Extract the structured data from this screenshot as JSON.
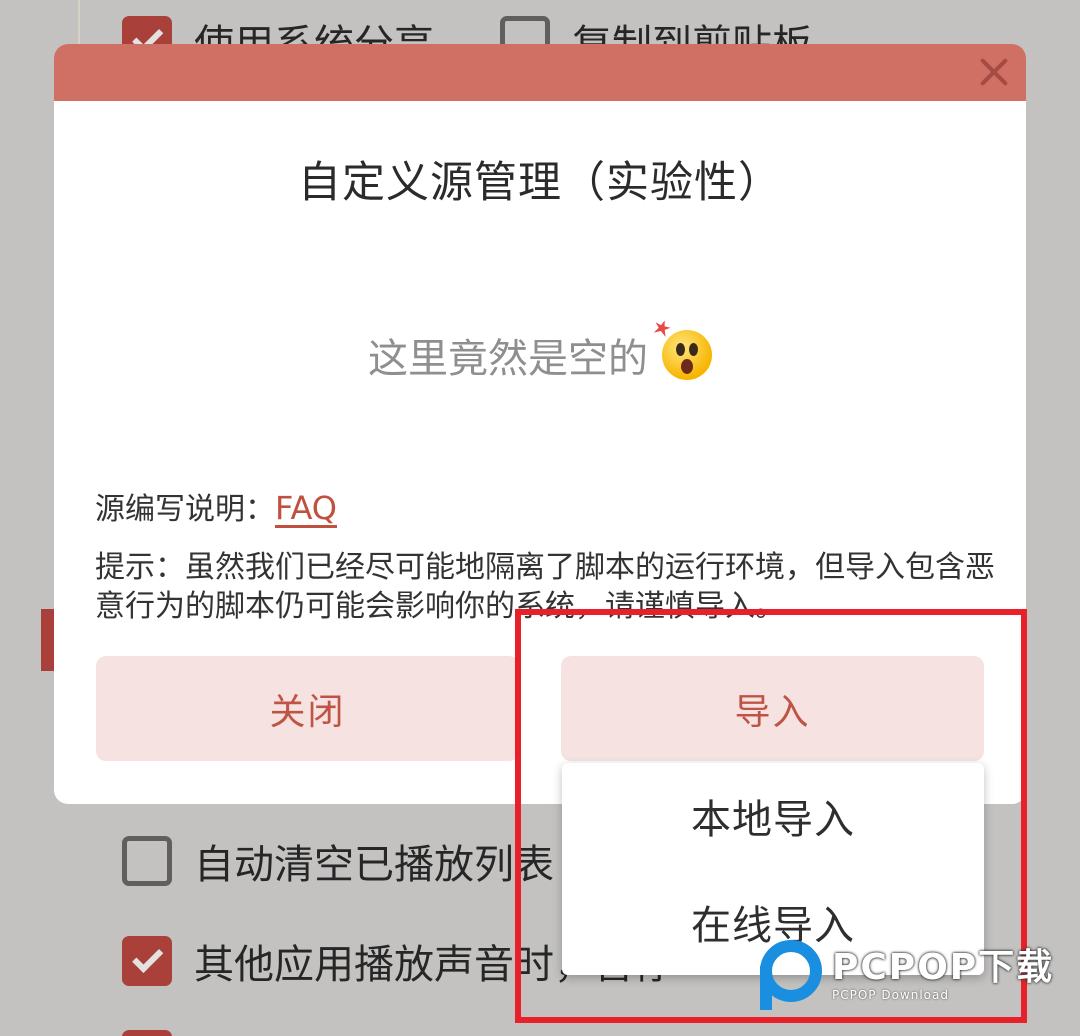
{
  "background": {
    "top_row": [
      {
        "label": "使用系统分享",
        "checked": true
      },
      {
        "label": "复制到剪贴板",
        "checked": false
      }
    ],
    "bottom_rows": [
      {
        "label": "自动清空已播放列表",
        "checked": false
      },
      {
        "label": "其他应用播放声音时，暂停",
        "checked": true
      }
    ]
  },
  "dialog": {
    "title": "自定义源管理（实验性）",
    "empty_text": "这里竟然是空的",
    "empty_icon": "astonished-face-icon",
    "faq_prefix": "源编写说明：",
    "faq_link": "FAQ",
    "hint": "提示：虽然我们已经尽可能地隔离了脚本的运行环境，但导入包含恶意行为的脚本仍可能会影响你的系统，请谨慎导入。",
    "close_button": "关闭",
    "import_button": "导入"
  },
  "import_menu": {
    "items": [
      "本地导入",
      "在线导入"
    ]
  },
  "watermark": {
    "main": "PCPOP下载",
    "sub": "PCPOP Download"
  },
  "colors": {
    "accent": "#a9413a",
    "header": "#d07065",
    "button_bg": "#f6e3e1",
    "button_text": "#bf5446",
    "annotation": "#e8202a"
  }
}
